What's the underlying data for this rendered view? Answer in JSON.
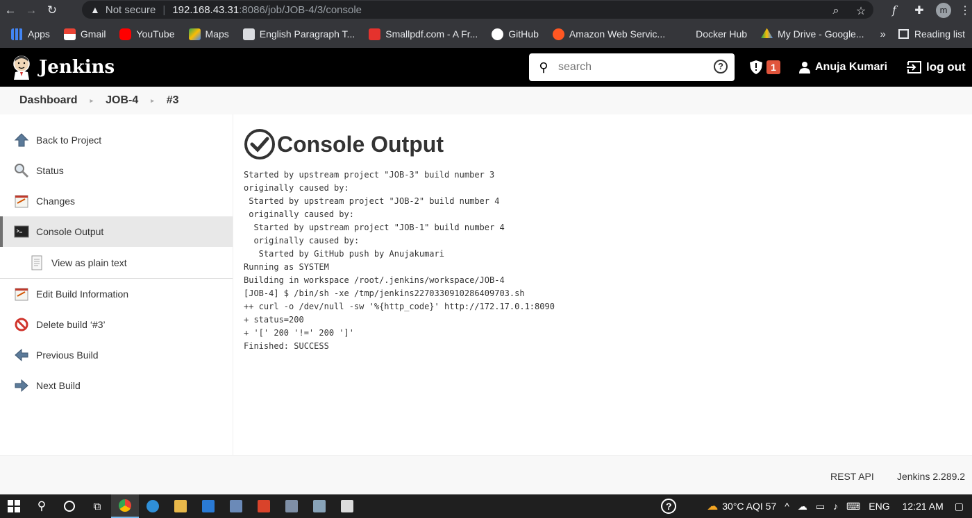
{
  "browser": {
    "not_secure": "Not secure",
    "url_host": "192.168.43.31",
    "url_path": ":8086/job/JOB-4/3/console",
    "profile_initial": "m"
  },
  "bookmarks": [
    {
      "label": "Apps",
      "icon": "apps-grid-icon",
      "color": "#4285f4"
    },
    {
      "label": "Gmail",
      "icon": "gmail-icon",
      "color": "#ea4335"
    },
    {
      "label": "YouTube",
      "icon": "youtube-icon",
      "color": "#ff0000"
    },
    {
      "label": "Maps",
      "icon": "maps-icon",
      "color": "#34a853"
    },
    {
      "label": "English Paragraph T...",
      "icon": "document-icon",
      "color": "#9aa0a6"
    },
    {
      "label": "Smallpdf.com - A Fr...",
      "icon": "smallpdf-icon",
      "color": "#e5322d"
    },
    {
      "label": "GitHub",
      "icon": "github-icon",
      "color": "#ffffff"
    },
    {
      "label": "Amazon Web Servic...",
      "icon": "aws-icon",
      "color": "#ff6600"
    },
    {
      "label": "Docker Hub",
      "icon": "docker-icon",
      "color": "#35363a"
    },
    {
      "label": "My Drive - Google...",
      "icon": "drive-icon",
      "color": "#fbbc04"
    }
  ],
  "bookmarks_more": "»",
  "reading_list": "Reading list",
  "jenkins": {
    "brand": "Jenkins",
    "search_placeholder": "search",
    "help": "?",
    "alert_count": "1",
    "user_name": "Anuja Kumari",
    "logout": "log out"
  },
  "breadcrumb": [
    "Dashboard",
    "JOB-4",
    "#3"
  ],
  "sidebar": {
    "back": "Back to Project",
    "status": "Status",
    "changes": "Changes",
    "console": "Console Output",
    "plain": "View as plain text",
    "edit": "Edit Build Information",
    "delete": "Delete build ‘#3’",
    "previous": "Previous Build",
    "next": "Next Build"
  },
  "page_title": "Console Output",
  "console_lines": [
    "Started by upstream project \"JOB-3\" build number 3",
    "originally caused by:",
    " Started by upstream project \"JOB-2\" build number 4",
    " originally caused by:",
    "  Started by upstream project \"JOB-1\" build number 4",
    "  originally caused by:",
    "   Started by GitHub push by Anujakumari",
    "Running as SYSTEM",
    "Building in workspace /root/.jenkins/workspace/JOB-4",
    "[JOB-4] $ /bin/sh -xe /tmp/jenkins2270330910286409703.sh",
    "++ curl -o /dev/null -sw '%{http_code}' http://172.17.0.1:8090",
    "+ status=200",
    "+ '[' 200 '!=' 200 ']'",
    "Finished: SUCCESS"
  ],
  "footer": {
    "rest_api": "REST API",
    "version": "Jenkins 2.289.2"
  },
  "taskbar": {
    "weather": "30°C  AQI 57",
    "language": "ENG",
    "time": "12:21 AM"
  }
}
